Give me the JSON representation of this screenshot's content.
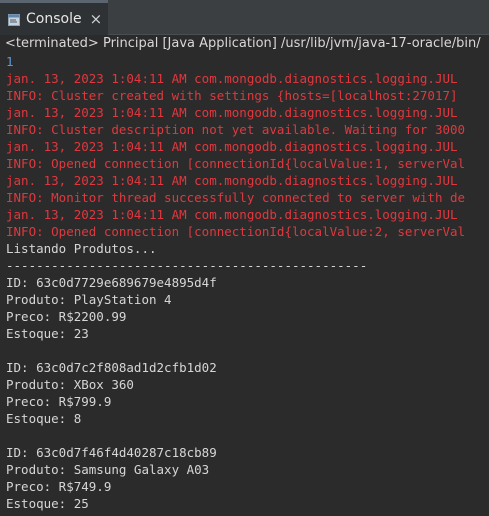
{
  "window": {
    "tab_label": "Console",
    "tab_icon": "console-icon",
    "close_icon": "close-icon",
    "close_glyph": "×"
  },
  "status_line": "<terminated> Principal [Java Application] /usr/lib/jvm/java-17-oracle/bin/",
  "colors": {
    "input": "#5c9bd6",
    "stderr": "#e0383e",
    "stdout": "#d6d6d6",
    "background": "#2b2b2b"
  },
  "console": {
    "lines": [
      {
        "type": "input",
        "text": "1"
      },
      {
        "type": "err",
        "text": "jan. 13, 2023 1:04:11 AM com.mongodb.diagnostics.logging.JUL"
      },
      {
        "type": "err",
        "text": "INFO: Cluster created with settings {hosts=[localhost:27017]"
      },
      {
        "type": "err",
        "text": "jan. 13, 2023 1:04:11 AM com.mongodb.diagnostics.logging.JUL"
      },
      {
        "type": "err",
        "text": "INFO: Cluster description not yet available. Waiting for 3000"
      },
      {
        "type": "err",
        "text": "jan. 13, 2023 1:04:11 AM com.mongodb.diagnostics.logging.JUL"
      },
      {
        "type": "err",
        "text": "INFO: Opened connection [connectionId{localValue:1, serverVal"
      },
      {
        "type": "err",
        "text": "jan. 13, 2023 1:04:11 AM com.mongodb.diagnostics.logging.JUL"
      },
      {
        "type": "err",
        "text": "INFO: Monitor thread successfully connected to server with de"
      },
      {
        "type": "err",
        "text": "jan. 13, 2023 1:04:11 AM com.mongodb.diagnostics.logging.JUL"
      },
      {
        "type": "err",
        "text": "INFO: Opened connection [connectionId{localValue:2, serverVal"
      },
      {
        "type": "out",
        "text": "Listando Produtos..."
      },
      {
        "type": "out",
        "text": "------------------------------------------------"
      },
      {
        "type": "out",
        "text": "ID: 63c0d7729e689679e4895d4f"
      },
      {
        "type": "out",
        "text": "Produto: PlayStation 4"
      },
      {
        "type": "out",
        "text": "Preco: R$2200.99"
      },
      {
        "type": "out",
        "text": "Estoque: 23"
      },
      {
        "type": "out",
        "text": ""
      },
      {
        "type": "out",
        "text": "ID: 63c0d7c2f808ad1d2cfb1d02"
      },
      {
        "type": "out",
        "text": "Produto: XBox 360"
      },
      {
        "type": "out",
        "text": "Preco: R$799.9"
      },
      {
        "type": "out",
        "text": "Estoque: 8"
      },
      {
        "type": "out",
        "text": ""
      },
      {
        "type": "out",
        "text": "ID: 63c0d7f46f4d40287c18cb89"
      },
      {
        "type": "out",
        "text": "Produto: Samsung Galaxy A03"
      },
      {
        "type": "out",
        "text": "Preco: R$749.9"
      },
      {
        "type": "out",
        "text": "Estoque: 25"
      }
    ]
  }
}
